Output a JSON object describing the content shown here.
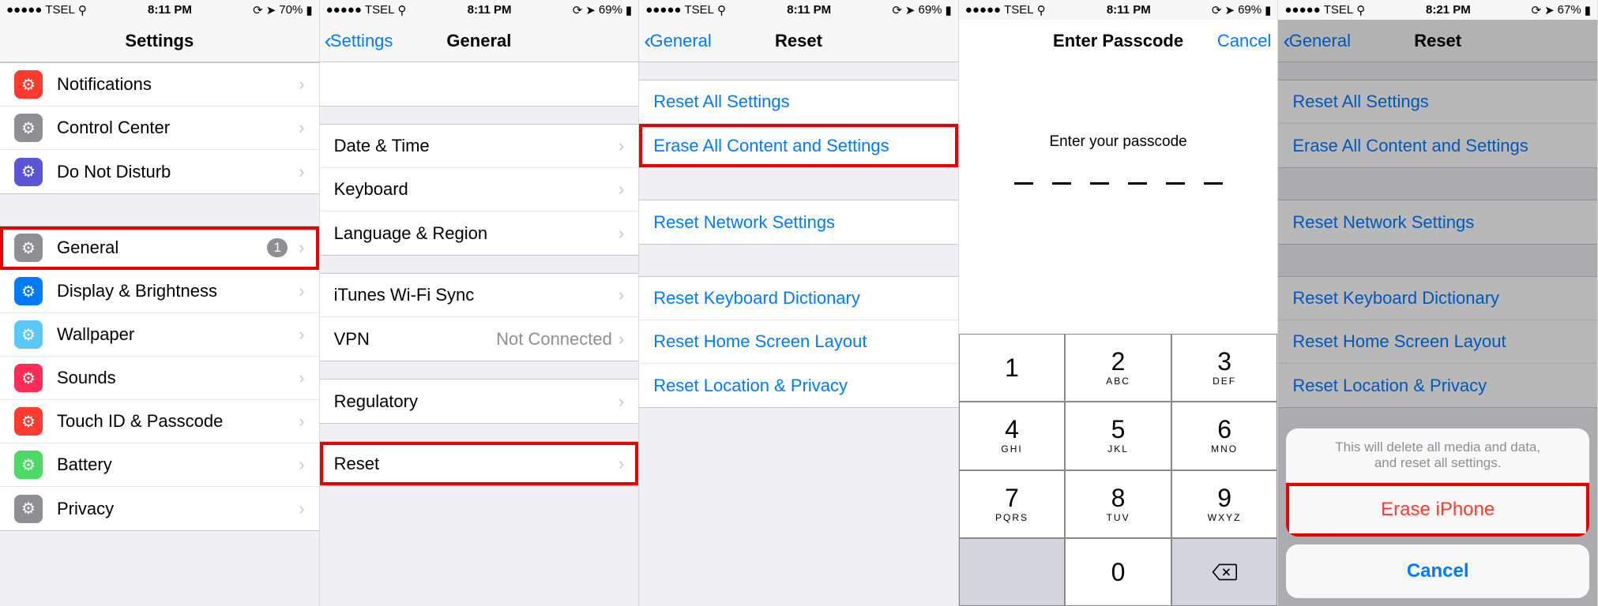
{
  "panel1": {
    "status": {
      "carrier": "TSEL",
      "time": "8:11 PM",
      "battery": "70%"
    },
    "title": "Settings",
    "rows": [
      {
        "label": "Notifications",
        "icon_color": "ic-red"
      },
      {
        "label": "Control Center",
        "icon_color": "ic-gray"
      },
      {
        "label": "Do Not Disturb",
        "icon_color": "ic-purple"
      }
    ],
    "rows2": [
      {
        "label": "General",
        "icon_color": "ic-gray",
        "badge": "1",
        "highlight": true
      },
      {
        "label": "Display & Brightness",
        "icon_color": "ic-blue"
      },
      {
        "label": "Wallpaper",
        "icon_color": "ic-cyan"
      },
      {
        "label": "Sounds",
        "icon_color": "ic-pink"
      },
      {
        "label": "Touch ID & Passcode",
        "icon_color": "ic-red"
      },
      {
        "label": "Battery",
        "icon_color": "ic-green"
      },
      {
        "label": "Privacy",
        "icon_color": "ic-gray"
      }
    ]
  },
  "panel2": {
    "status": {
      "carrier": "TSEL",
      "time": "8:11 PM",
      "battery": "69%"
    },
    "back": "Settings",
    "title": "General",
    "g1": [
      {
        "label": "Date & Time"
      },
      {
        "label": "Keyboard"
      },
      {
        "label": "Language & Region"
      }
    ],
    "g2": [
      {
        "label": "iTunes Wi-Fi Sync"
      },
      {
        "label": "VPN",
        "value": "Not Connected"
      }
    ],
    "g3": [
      {
        "label": "Regulatory"
      }
    ],
    "g4": [
      {
        "label": "Reset",
        "highlight": true
      }
    ]
  },
  "panel3": {
    "status": {
      "carrier": "TSEL",
      "time": "8:11 PM",
      "battery": "69%"
    },
    "back": "General",
    "title": "Reset",
    "g1": [
      {
        "label": "Reset All Settings"
      },
      {
        "label": "Erase All Content and Settings",
        "highlight": true
      }
    ],
    "g2": [
      {
        "label": "Reset Network Settings"
      }
    ],
    "g3": [
      {
        "label": "Reset Keyboard Dictionary"
      },
      {
        "label": "Reset Home Screen Layout"
      },
      {
        "label": "Reset Location & Privacy"
      }
    ]
  },
  "panel4": {
    "status": {
      "carrier": "TSEL",
      "time": "8:11 PM",
      "battery": "69%"
    },
    "title": "Enter Passcode",
    "cancel": "Cancel",
    "msg": "Enter your passcode",
    "keys": [
      {
        "n": "1",
        "l": ""
      },
      {
        "n": "2",
        "l": "ABC"
      },
      {
        "n": "3",
        "l": "DEF"
      },
      {
        "n": "4",
        "l": "GHI"
      },
      {
        "n": "5",
        "l": "JKL"
      },
      {
        "n": "6",
        "l": "MNO"
      },
      {
        "n": "7",
        "l": "PQRS"
      },
      {
        "n": "8",
        "l": "TUV"
      },
      {
        "n": "9",
        "l": "WXYZ"
      },
      {
        "blank": true
      },
      {
        "n": "0",
        "l": ""
      },
      {
        "del": true
      }
    ]
  },
  "panel5": {
    "status": {
      "carrier": "TSEL",
      "time": "8:21 PM",
      "battery": "67%"
    },
    "back": "General",
    "title": "Reset",
    "g1": [
      {
        "label": "Reset All Settings"
      },
      {
        "label": "Erase All Content and Settings"
      }
    ],
    "g2": [
      {
        "label": "Reset Network Settings"
      }
    ],
    "g3": [
      {
        "label": "Reset Keyboard Dictionary"
      },
      {
        "label": "Reset Home Screen Layout"
      },
      {
        "label": "Reset Location & Privacy"
      }
    ],
    "sheet": {
      "msg": "This will delete all media and data,\nand reset all settings.",
      "erase": "Erase iPhone",
      "cancel": "Cancel"
    }
  }
}
